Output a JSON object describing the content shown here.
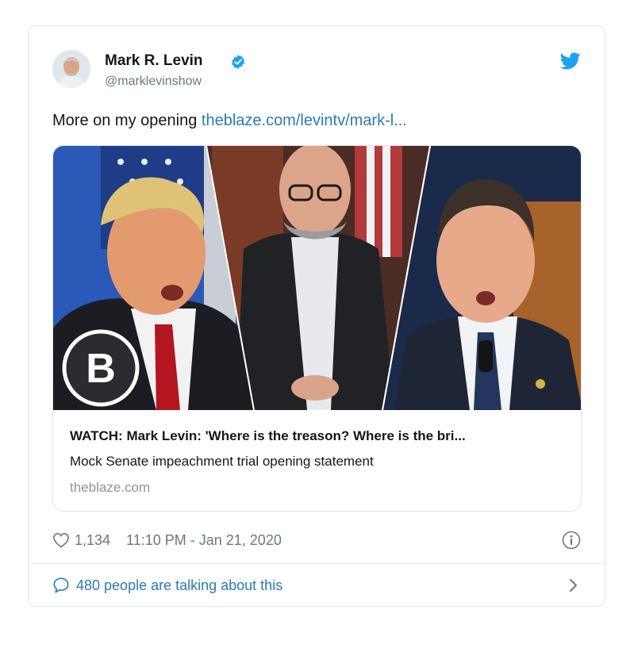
{
  "tweet": {
    "author": {
      "name": "Mark R. Levin",
      "handle": "@marklevinshow"
    },
    "text": "More on my opening ",
    "link_text": "theblaze.com/levintv/mark-l...",
    "card": {
      "title": "WATCH: Mark Levin: 'Where is the treason? Where is the bri...",
      "description": "Mock Senate impeachment trial opening statement",
      "domain": "theblaze.com"
    },
    "likes": "1,134",
    "timestamp": "11:10 PM - Jan 21, 2020",
    "conversation": "480 people are talking about this"
  },
  "icons": {
    "verified": "verified-badge-icon",
    "bird": "twitter-bird-icon",
    "heart": "heart-icon",
    "info": "info-icon",
    "bubble": "speech-bubble-icon",
    "chevron": "chevron-right-icon"
  },
  "colors": {
    "brand_blue": "#1da1f2",
    "link": "#2b7bb9",
    "secondary_text": "#697882",
    "border": "#dfe3e7"
  }
}
